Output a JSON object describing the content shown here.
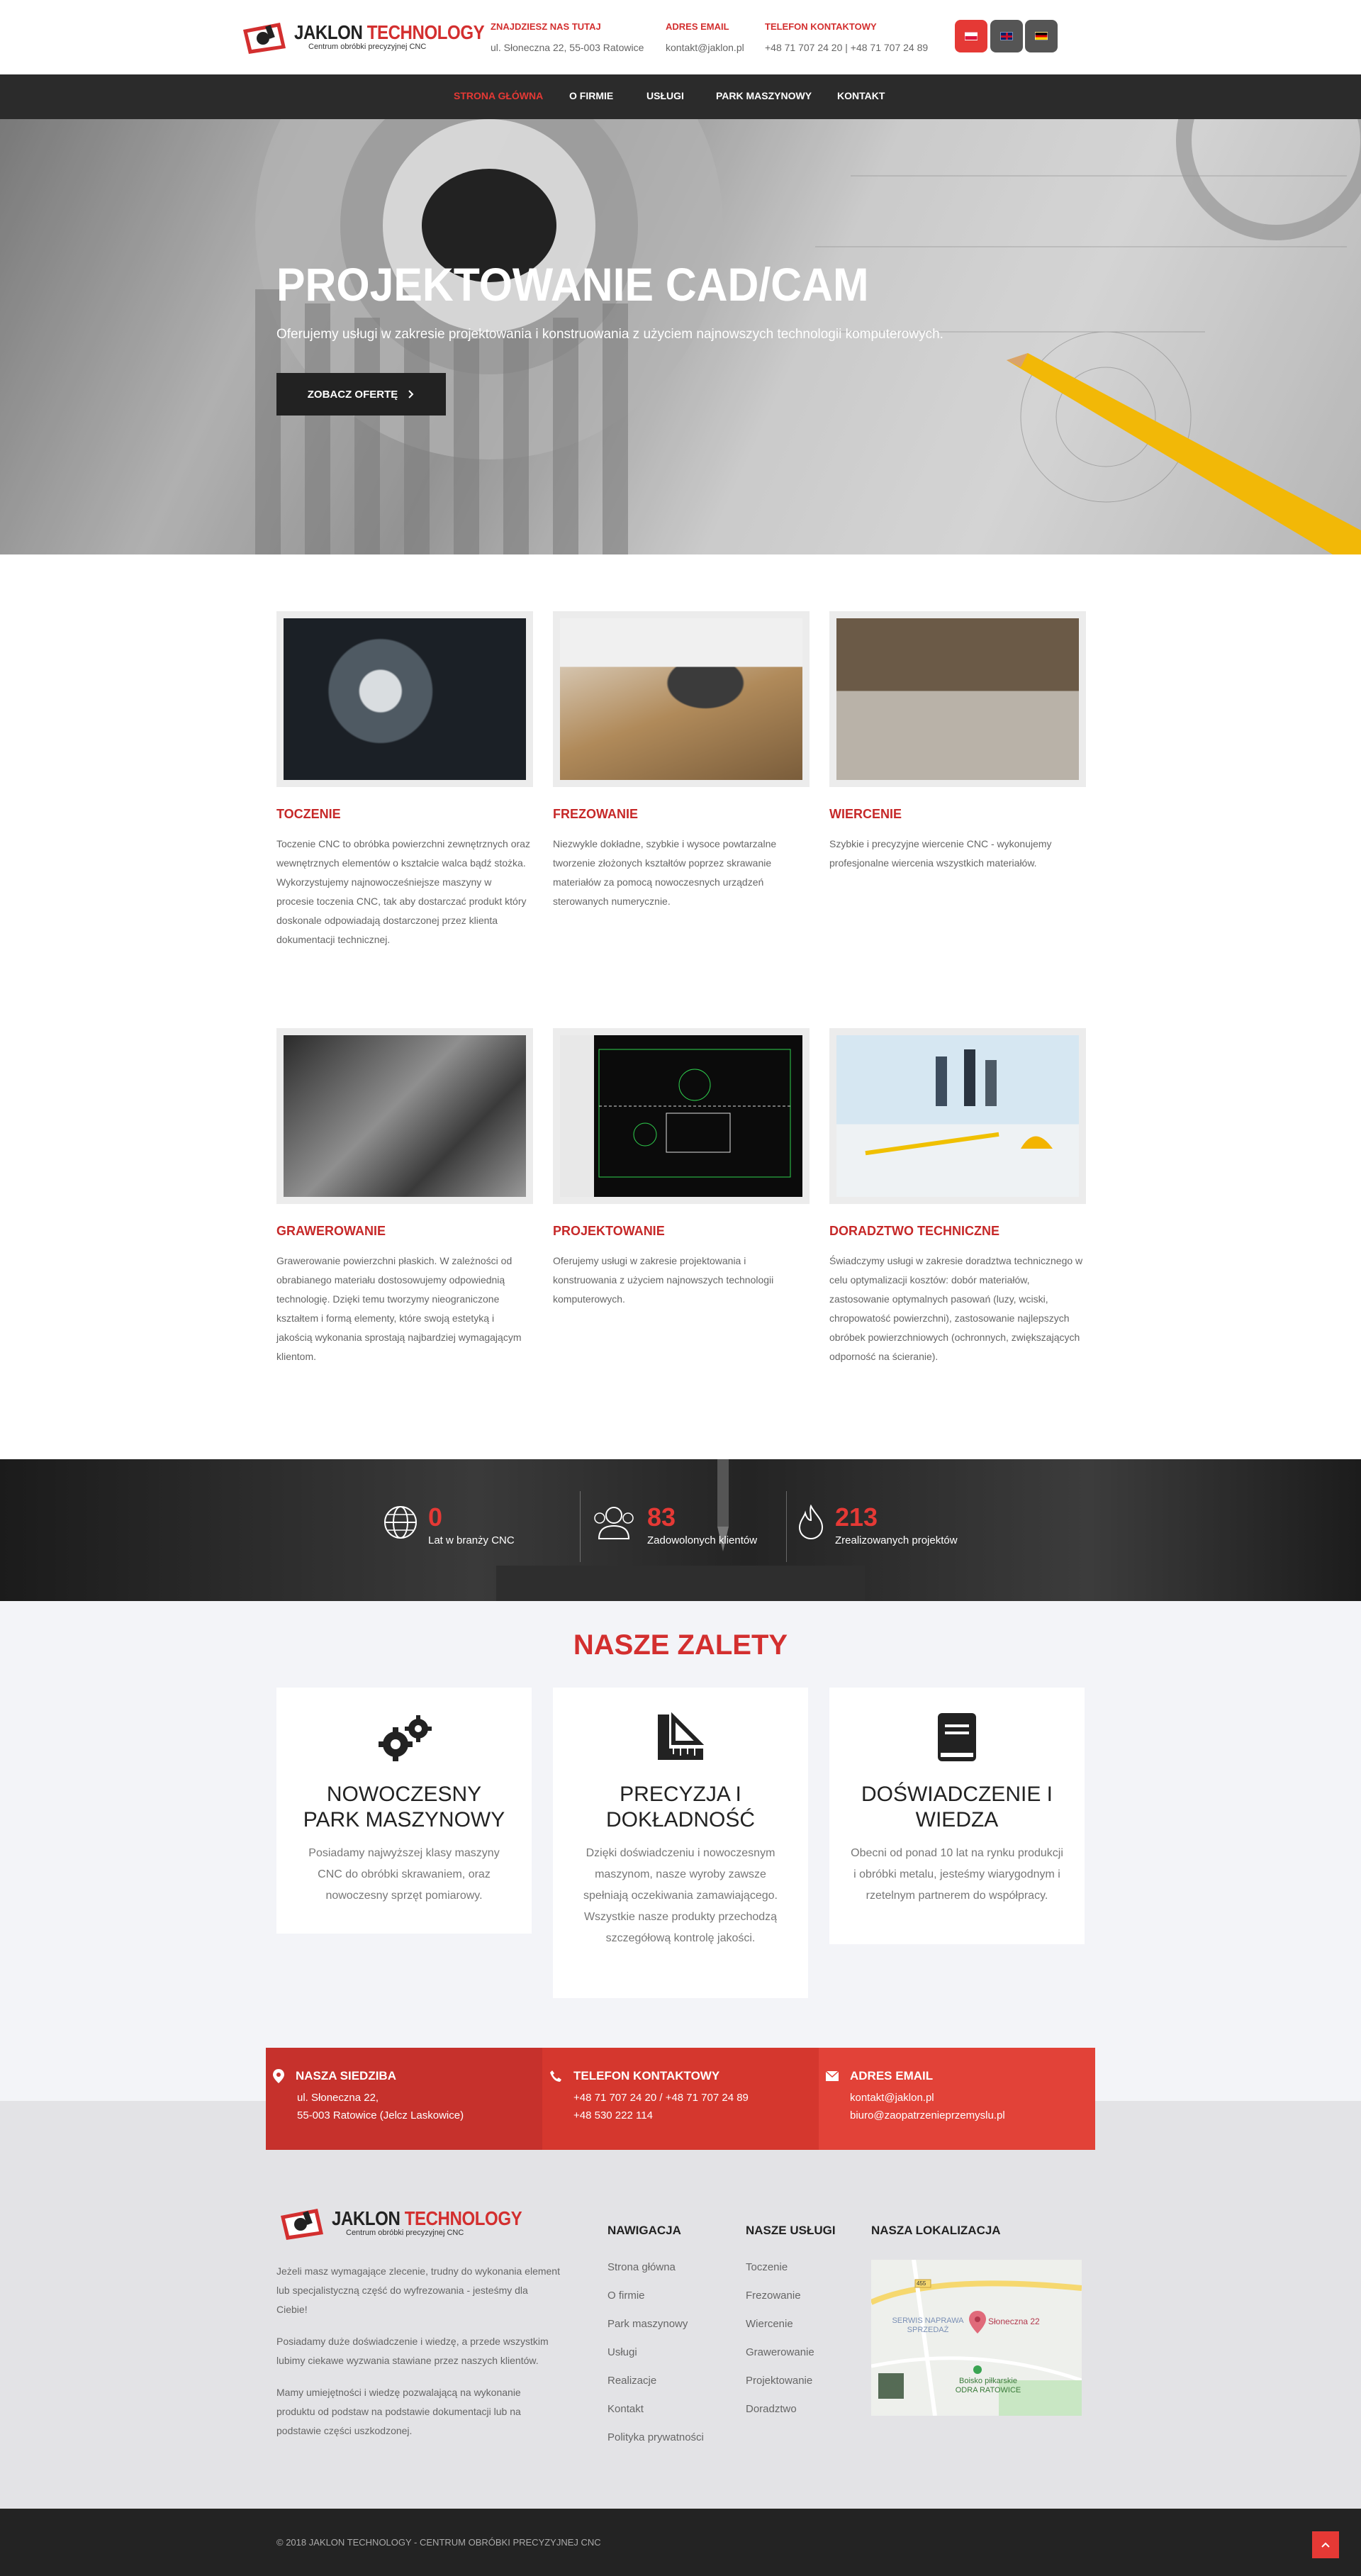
{
  "colors": {
    "accent": "#d32f2f",
    "dark": "#2b2b2b",
    "footer_bg": "#e3e3e6"
  },
  "header": {
    "logo": {
      "title_left": "JAKLON",
      "title_right": "TECHNOLOGY",
      "subtitle": "Centrum obróbki precyzyjnej CNC"
    },
    "address": {
      "label": "ZNAJDZIESZ NAS TUTAJ",
      "value": "ul. Słoneczna 22, 55-003 Ratowice"
    },
    "email": {
      "label": "ADRES EMAIL",
      "value": "kontakt@jaklon.pl"
    },
    "phone": {
      "label": "TELEFON KONTAKTOWY",
      "value": "+48 71 707 24 20 | +48 71 707 24 89"
    },
    "languages": [
      {
        "name": "pl-flag-icon",
        "color": "#e53935"
      },
      {
        "name": "uk-flag-icon",
        "color": "#555"
      },
      {
        "name": "de-flag-icon",
        "color": "#555"
      }
    ]
  },
  "nav": {
    "items": [
      {
        "label": "STRONA GŁÓWNA",
        "active": true
      },
      {
        "label": "O FIRMIE"
      },
      {
        "label": "USŁUGI",
        "has_dropdown": true
      },
      {
        "label": "PARK MASZYNOWY"
      },
      {
        "label": "KONTAKT"
      }
    ]
  },
  "hero": {
    "title": "PROJEKTOWANIE CAD/CAM",
    "subtitle": "Oferujemy usługi w zakresie projektowania i konstruowania z użyciem najnowszych technologii komputerowych.",
    "button": "ZOBACZ OFERTĘ"
  },
  "services": [
    {
      "title": "TOCZENIE",
      "text": "Toczenie CNC to obróbka powierzchni zewnętrznych oraz wewnętrznych elementów o kształcie walca bądź stożka. Wykorzystujemy najnowocześniejsze maszyny w procesie toczenia CNC, tak aby dostarczać produkt który doskonale odpowiadają dostarczonej przez klienta dokumentacji technicznej."
    },
    {
      "title": "FREZOWANIE",
      "text": "Niezwykle dokładne, szybkie i wysoce powtarzalne tworzenie złożonych kształtów poprzez skrawanie materiałów za pomocą nowoczesnych urządzeń sterowanych numerycznie."
    },
    {
      "title": "WIERCENIE",
      "text": "Szybkie i precyzyjne wiercenie CNC - wykonujemy profesjonalne wiercenia wszystkich materiałów."
    },
    {
      "title": "GRAWEROWANIE",
      "text": "Grawerowanie powierzchni płaskich. W zależności od obrabianego materiału dostosowujemy odpowiednią technologię. Dzięki temu tworzymy nieograniczone kształtem i formą elementy, które swoją estetyką i jakością wykonania sprostają najbardziej wymagającym klientom."
    },
    {
      "title": "PROJEKTOWANIE",
      "text": "Oferujemy usługi w zakresie projektowania i konstruowania z użyciem najnowszych technologii komputerowych."
    },
    {
      "title": "DORADZTWO TECHNICZNE",
      "text": "Świadczymy usługi w zakresie doradztwa technicznego w celu optymalizacji kosztów: dobór materiałów, zastosowanie optymalnych pasowań (luzy, wciski, chropowatość powierzchni), zastosowanie najlepszych obróbek powierzchniowych (ochronnych, zwiększających odporność na ścieranie)."
    }
  ],
  "stats": [
    {
      "value": "0",
      "label": "Lat w branży CNC",
      "icon": "globe-icon"
    },
    {
      "value": "83",
      "label": "Zadowolonych klientów",
      "icon": "users-icon"
    },
    {
      "value": "213",
      "label": "Zrealizowanych projektów",
      "icon": "flame-icon"
    }
  ],
  "advantages": {
    "heading": "NASZE ZALETY",
    "items": [
      {
        "title": "NOWOCZESNY PARK MASZYNOWY",
        "text": "Posiadamy najwyższej klasy maszyny CNC do obróbki skrawaniem, oraz nowoczesny sprzęt pomiarowy.",
        "icon": "gears-icon"
      },
      {
        "title": "PRECYZJA I DOKŁADNOŚĆ",
        "text": "Dzięki doświadczeniu i nowoczesnym maszynom, nasze wyroby zawsze spełniają oczekiwania zamawiającego. Wszystkie nasze produkty przechodzą szczegółową kontrolę jakości.",
        "icon": "ruler-icon"
      },
      {
        "title": "DOŚWIADCZENIE I WIEDZA",
        "text": "Obecni od ponad 10 lat na rynku produkcji i obróbki metalu, jesteśmy wiarygodnym i rzetelnym partnerem do współpracy.",
        "icon": "book-icon"
      }
    ]
  },
  "contact_strip": [
    {
      "head": "NASZA SIEDZIBA",
      "lines": [
        "ul. Słoneczna 22,",
        "55-003 Ratowice (Jelcz Laskowice)"
      ],
      "icon": "map-pin-icon"
    },
    {
      "head": "TELEFON KONTAKTOWY",
      "lines": [
        "+48 71 707 24 20 / +48 71 707 24 89",
        "+48 530 222 114"
      ],
      "icon": "phone-icon"
    },
    {
      "head": "ADRES EMAIL",
      "lines": [
        "kontakt@jaklon.pl",
        "biuro@zaopatrzenieprzemyslu.pl"
      ],
      "icon": "envelope-icon"
    }
  ],
  "footer": {
    "about": [
      "Jeżeli masz wymagające zlecenie, trudny do wykonania element lub specjalistyczną część do wyfrezowania - jesteśmy dla Ciebie!",
      "Posiadamy duże doświadczenie i wiedzę, a przede wszystkim lubimy ciekawe wyzwania stawiane przez naszych klientów.",
      "Mamy umiejętności i wiedzę pozwalającą na wykonanie produktu od podstaw na podstawie dokumentacji lub na podstawie części uszkodzonej."
    ],
    "nav_heading": "NAWIGACJA",
    "nav_links": [
      "Strona główna",
      "O firmie",
      "Park maszynowy",
      "Usługi",
      "Realizacje",
      "Kontakt",
      "Polityka prywatności"
    ],
    "services_heading": "NASZE USŁUGI",
    "services_links": [
      "Toczenie",
      "Frezowanie",
      "Wiercenie",
      "Grawerowanie",
      "Projektowanie",
      "Doradztwo"
    ],
    "map_heading": "NASZA LOKALIZACJA",
    "map": {
      "marker": "Słoneczna 22",
      "label_service": "SERWIS NAPRAWA SPRZEDAŻ",
      "label_pitch": "Boisko piłkarskie ODRA RATOWICE",
      "label_road": "455"
    }
  },
  "copyright": "© 2018 JAKLON TECHNOLOGY - CENTRUM OBRÓBKI PRECYZYJNEJ CNC"
}
